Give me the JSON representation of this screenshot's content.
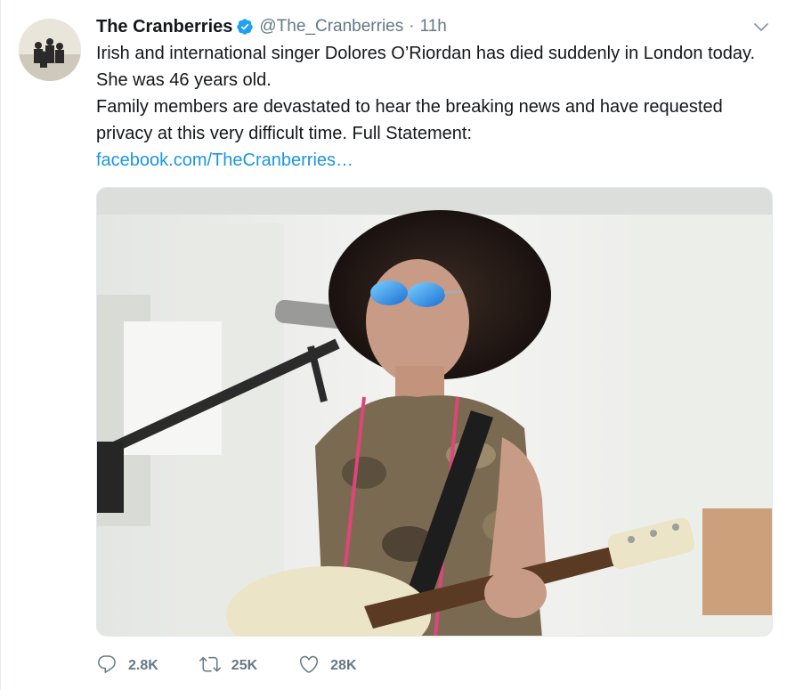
{
  "tweet": {
    "author_name": "The Cranberries",
    "handle": "@The_Cranberries",
    "separator": "·",
    "time": "11h",
    "text_line1": "Irish and international singer Dolores O’Riordan has died suddenly in London today. She was 46 years old.",
    "text_line2": "Family members are devastated to hear the breaking news and have requested privacy at this very difficult time. Full Statement:",
    "link_text": "facebook.com/TheCranberries…"
  },
  "actions": {
    "replies": "2.8K",
    "retweets": "25K",
    "likes": "28K"
  },
  "icons": {
    "verified": "verified-badge-icon",
    "more": "chevron-down-icon",
    "reply": "reply-icon",
    "retweet": "retweet-icon",
    "like": "heart-icon"
  },
  "colors": {
    "name": "#14171a",
    "secondary": "#657786",
    "link": "#1b95e0",
    "verified": "#1da1f2"
  }
}
